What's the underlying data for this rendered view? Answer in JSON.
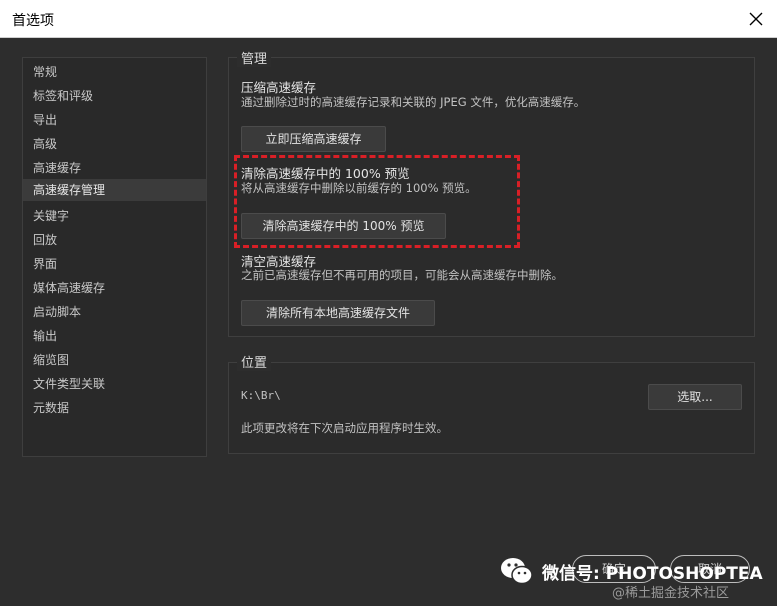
{
  "window": {
    "title": "首选项",
    "close_icon": "close-icon"
  },
  "sidebar": {
    "items": [
      {
        "label": "常规"
      },
      {
        "label": "标签和评级"
      },
      {
        "label": "导出"
      },
      {
        "label": "高级"
      },
      {
        "label": "高速缓存"
      },
      {
        "label": "高速缓存管理",
        "selected": true
      },
      {
        "label": "关键字"
      },
      {
        "label": "回放"
      },
      {
        "label": "界面"
      },
      {
        "label": "媒体高速缓存"
      },
      {
        "label": "启动脚本"
      },
      {
        "label": "输出"
      },
      {
        "label": "缩览图"
      },
      {
        "label": "文件类型关联"
      },
      {
        "label": "元数据"
      }
    ]
  },
  "manage": {
    "title": "管理",
    "compact": {
      "heading": "压缩高速缓存",
      "desc": "通过删除过时的高速缓存记录和关联的 JPEG 文件，优化高速缓存。",
      "button": "立即压缩高速缓存"
    },
    "purge100": {
      "heading": "清除高速缓存中的 100% 预览",
      "desc": "将从高速缓存中删除以前缓存的 100% 预览。",
      "button": "清除高速缓存中的 100% 预览"
    },
    "clear": {
      "heading": "清空高速缓存",
      "desc": "之前已高速缓存但不再可用的项目，可能会从高速缓存中删除。",
      "button": "清除所有本地高速缓存文件"
    }
  },
  "location": {
    "title": "位置",
    "path": "K:\\Br\\",
    "choose_button": "选取...",
    "note": "此项更改将在下次启动应用程序时生效。"
  },
  "footer": {
    "ok_button": "确定",
    "cancel_button": "取消"
  },
  "watermark": {
    "text": "微信号: PHOTOSHOPTEA",
    "sub": "@稀土掘金技术社区"
  },
  "colors": {
    "background": "#2d2d2d",
    "highlight_border": "#d91f26",
    "titlebar": "#ffffff"
  }
}
